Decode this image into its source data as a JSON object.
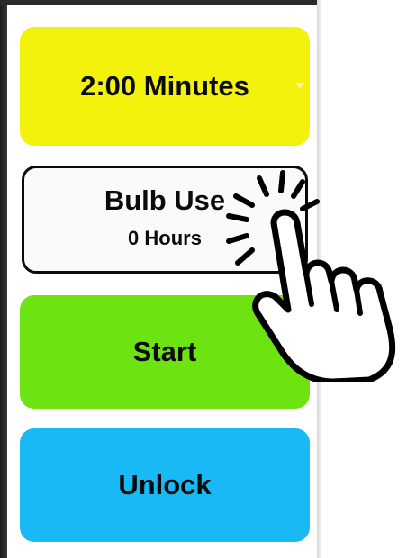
{
  "timer": {
    "label": "2:00 Minutes"
  },
  "bulb_use": {
    "title": "Bulb Use",
    "value": "0 Hours"
  },
  "start": {
    "label": "Start"
  },
  "unlock": {
    "label": "Unlock"
  },
  "colors": {
    "timer_bg": "#f2f20c",
    "bulb_bg": "#fafafa",
    "start_bg": "#6de412",
    "unlock_bg": "#18b9f4"
  },
  "icons": {
    "dropdown": "chevron-down-icon",
    "pointer": "tap-hand-icon"
  }
}
